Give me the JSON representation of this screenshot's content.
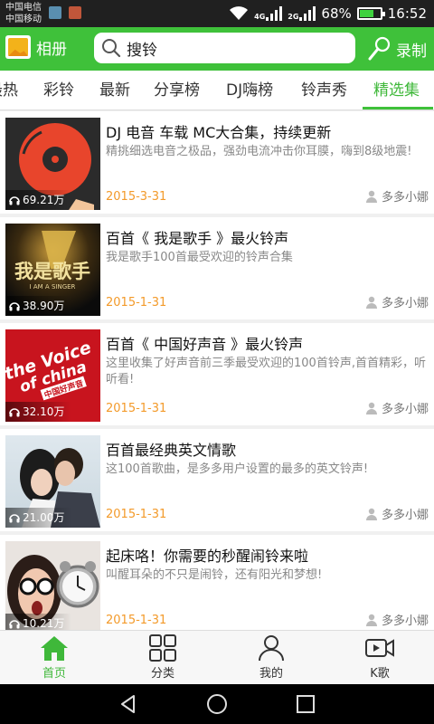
{
  "status_bar": {
    "carrier_1": "中国电信",
    "carrier_2": "中国移动",
    "network_1": "4G",
    "network_2": "2G",
    "battery": "68%",
    "battery_level": 0.68,
    "time": "16:52"
  },
  "header": {
    "album_label": "相册",
    "search_value": "搜铃",
    "record_label": "录制"
  },
  "tabs": [
    {
      "label": "最热"
    },
    {
      "label": "彩铃"
    },
    {
      "label": "最新"
    },
    {
      "label": "分享榜"
    },
    {
      "label": "DJ嗨榜"
    },
    {
      "label": "铃声秀"
    },
    {
      "label": "精选集",
      "active": true
    }
  ],
  "items": [
    {
      "title": "DJ 电音 车载 MC大合集，持续更新",
      "desc": "精挑细选电音之极品，强劲电流冲击你耳膜，嗨到8级地震!",
      "plays": "69.21万",
      "date": "2015-3-31",
      "author": "多多小娜"
    },
    {
      "title": "百首《 我是歌手 》最火铃声",
      "desc": "我是歌手100首最受欢迎的铃声合集",
      "plays": "38.90万",
      "date": "2015-1-31",
      "author": "多多小娜",
      "thumb_text_1": "我是歌手",
      "thumb_text_2": "I AM A SINGER"
    },
    {
      "title": "百首《 中国好声音 》最火铃声",
      "desc": "这里收集了好声音前三季最受欢迎的100首铃声,首首精彩，听听看!",
      "plays": "32.10万",
      "date": "2015-1-31",
      "author": "多多小娜",
      "thumb_text_1": "the Voice",
      "thumb_text_2": "of china",
      "thumb_text_3": "中国好声音"
    },
    {
      "title": "百首最经典英文情歌",
      "desc": "这100首歌曲，是多多用户设置的最多的英文铃声!",
      "plays": "21.00万",
      "date": "2015-1-31",
      "author": "多多小娜"
    },
    {
      "title": "起床咯！你需要的秒醒闹铃来啦",
      "desc": "叫醒耳朵的不只是闹铃，还有阳光和梦想!",
      "plays": "10.21万",
      "date": "2015-1-31",
      "author": "多多小娜"
    }
  ],
  "bottom_nav": [
    {
      "label": "首页",
      "active": true
    },
    {
      "label": "分类"
    },
    {
      "label": "我的"
    },
    {
      "label": "K歌"
    }
  ],
  "colors": {
    "accent": "#3fc13a",
    "date": "#f39a2a"
  }
}
